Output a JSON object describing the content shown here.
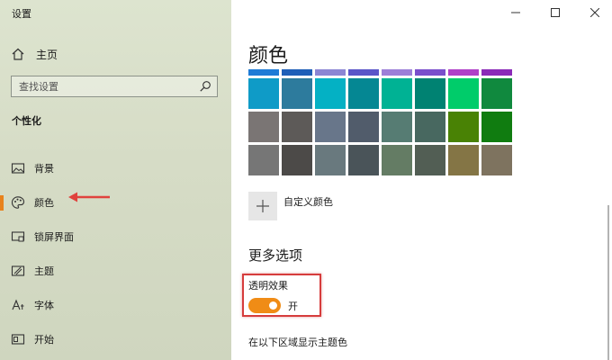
{
  "window": {
    "title": "设置"
  },
  "sidebar": {
    "home_label": "主页",
    "search_placeholder": "查找设置",
    "section_title": "个性化",
    "items": [
      {
        "label": "背景",
        "icon": "picture-icon"
      },
      {
        "label": "颜色",
        "icon": "palette-icon",
        "active": true
      },
      {
        "label": "锁屏界面",
        "icon": "lock-screen-icon"
      },
      {
        "label": "主题",
        "icon": "theme-icon"
      },
      {
        "label": "字体",
        "icon": "font-icon"
      },
      {
        "label": "开始",
        "icon": "start-icon"
      }
    ]
  },
  "main": {
    "title": "颜色",
    "strip_colors": [
      "#1e7bd6",
      "#1e5fb8",
      "#8c86d4",
      "#5a55c8",
      "#9d7fd8",
      "#7a4fcc",
      "#b040c8",
      "#8a2ab8"
    ],
    "swatch_colors": [
      "#0f9bc7",
      "#2d7b9d",
      "#04b1c4",
      "#058793",
      "#00b294",
      "#008272",
      "#00cc6a",
      "#10893e",
      "#7a7574",
      "#5d5a58",
      "#68768a",
      "#515c6b",
      "#567c73",
      "#486860",
      "#498205",
      "#107c10",
      "#767676",
      "#4c4a48",
      "#69797e",
      "#4a5459",
      "#647c64",
      "#525e54",
      "#847545",
      "#7e735f"
    ],
    "custom_color_label": "自定义颜色",
    "more_options_title": "更多选项",
    "transparency_label": "透明效果",
    "transparency_state": "开",
    "transparency_on": true,
    "show_accent_label": "在以下区域显示主题色"
  },
  "colors": {
    "accent": "#f08c16",
    "highlight": "#d63c3c"
  }
}
